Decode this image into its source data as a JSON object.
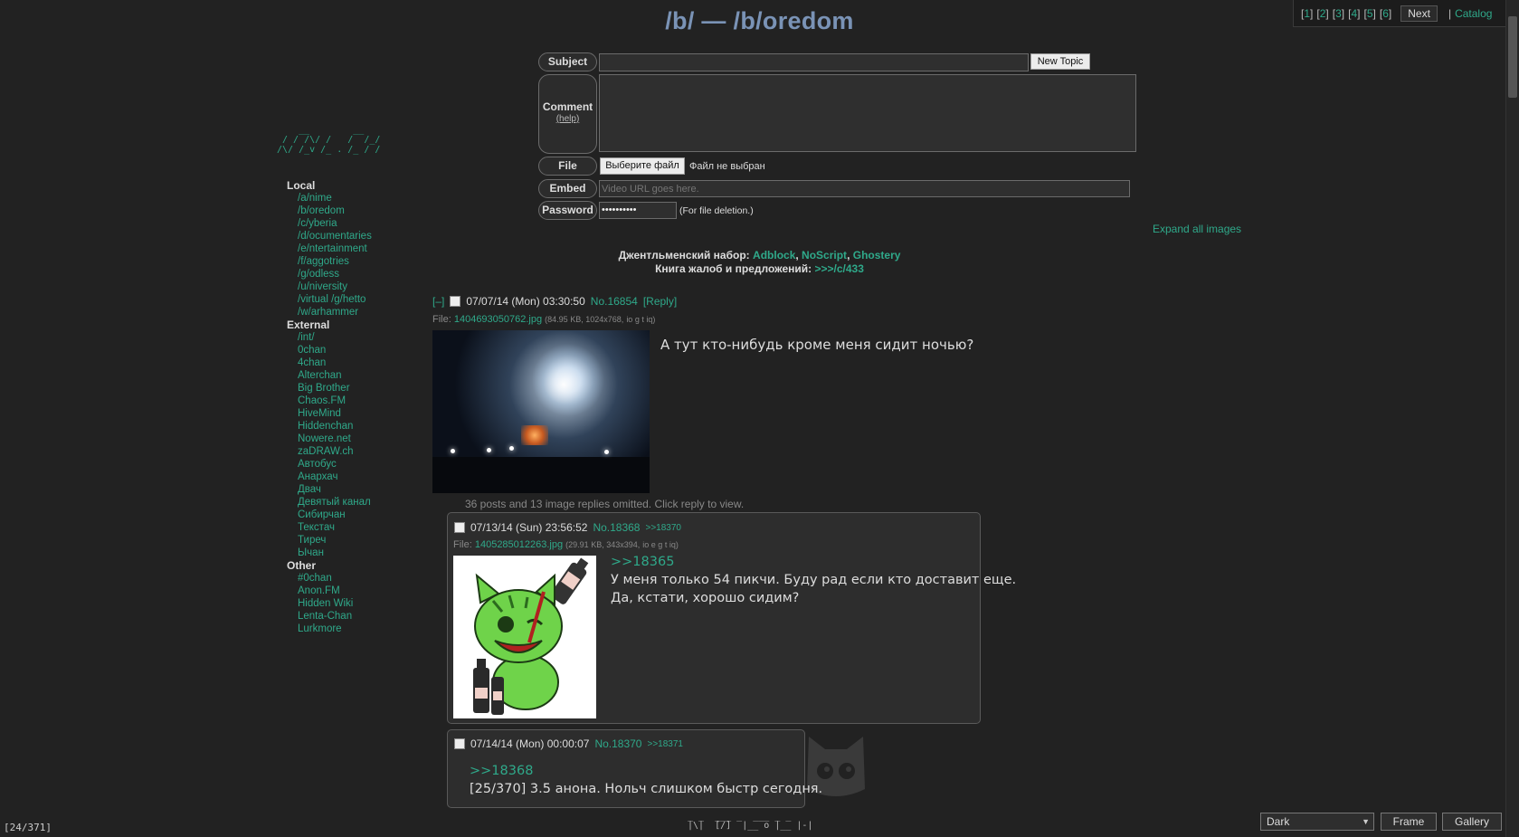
{
  "pager": {
    "pages": [
      "1",
      "2",
      "3",
      "4",
      "5",
      "6"
    ],
    "next_label": "Next",
    "separator": "|",
    "catalog_label": "Catalog"
  },
  "board_title": "/b/ — /b/oredom",
  "form": {
    "subject_label": "Subject",
    "new_topic_label": "New Topic",
    "comment_label": "Comment",
    "help_label": "(help)",
    "file_label": "File",
    "choose_file_label": "Выберите файл",
    "no_file_text": "Файл не выбран",
    "embed_label": "Embed",
    "embed_placeholder": "Video URL goes here.",
    "password_label": "Password",
    "password_value": "••••••••••",
    "password_hint": "(For file deletion.)"
  },
  "expand_all_label": "Expand all images",
  "notice": {
    "line1_prefix": "Джентльменский набор:",
    "links": [
      "Adblock",
      "NoScript",
      "Ghostery"
    ],
    "line2_prefix": "Книга жалоб и предложений:",
    "line2_link": ">>>/c/433"
  },
  "sidebar": {
    "ascii_art": "    __        __\n / / /\\/ /   /  /_/\n/\\/ /_v /_ . /_ / /",
    "sections": [
      {
        "title": "Local",
        "items": [
          "/a/nime",
          "/b/oredom",
          "/c/yberia",
          "/d/ocumentaries",
          "/e/ntertainment",
          "/f/aggotries",
          "/g/odless",
          "/u/niversity",
          "/virtual /g/hetto",
          "/w/arhammer"
        ]
      },
      {
        "title": "External",
        "items": [
          "/int/",
          "0chan",
          "4chan",
          "Alterchan",
          "Big Brother",
          "Chaos.FM",
          "HiveMind",
          "Hiddenchan",
          "Nowere.net",
          "zaDRAW.ch",
          "Автобус",
          "Анархач",
          "Двач",
          "Девятый канал",
          "Сибирчан",
          "Текстач",
          "Тиреч",
          "Ычан"
        ]
      },
      {
        "title": "Other",
        "items": [
          "#0chan",
          "Anon.FM",
          "Hidden Wiki",
          "Lenta-Chan",
          "Lurkmore"
        ]
      }
    ]
  },
  "op": {
    "collapse": "[–]",
    "date": "07/07/14 (Mon) 03:30:50",
    "number": "No.16854",
    "reply_link": "[Reply]",
    "file_prefix": "File:",
    "file_name": "1404693050762.jpg",
    "file_meta": "(84.95 KB, 1024x768,",
    "file_search": "io g t iq)",
    "text": "А тут кто-нибудь кроме меня сидит ночью?",
    "omitted": "36 posts and 13 image replies omitted. Click reply to view."
  },
  "replies": [
    {
      "date": "07/13/14 (Sun) 23:56:52",
      "number": "No.18368",
      "backlink": ">>18370",
      "file_prefix": "File:",
      "file_name": "1405285012263.jpg",
      "file_meta": "(29.91 KB, 343x394,",
      "file_search": "io e g t iq)",
      "quote": ">>18365",
      "lines": [
        "У меня только 54 пикчи. Буду рад если кто доставит еще.",
        "Да, кстати, хорошо сидим?"
      ]
    },
    {
      "date": "07/14/14 (Mon) 00:00:07",
      "number": "No.18370",
      "backlink": ">>18371",
      "quote": ">>18368",
      "lines": [
        "[25/370] 3.5 анона. Нольч слишком быстр сегодня."
      ]
    }
  ],
  "footer": {
    "ascii_art": "_ _  ___ _  ___ _ _\n|\\|  [/]  |__ o |__ |-|",
    "counter": "[24/371]",
    "style_value": "Dark",
    "frame_label": "Frame",
    "gallery_label": "Gallery"
  },
  "colors": {
    "background": "#222222",
    "link": "#2fa98a",
    "title": "#7a93b6"
  }
}
